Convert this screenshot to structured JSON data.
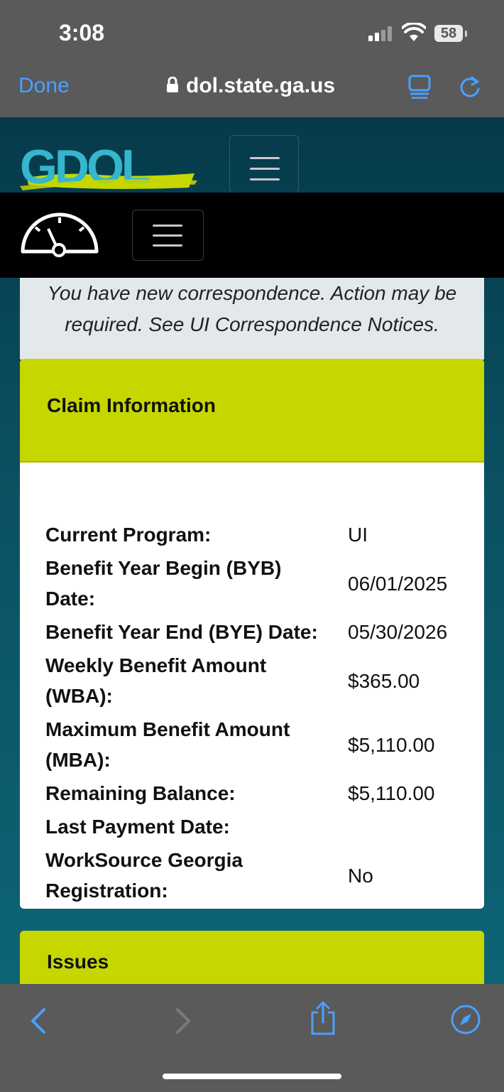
{
  "status_bar": {
    "time": "3:08",
    "battery": "58"
  },
  "browser": {
    "done_label": "Done",
    "url": "dol.state.ga.us"
  },
  "site": {
    "logo_text": "GDOL"
  },
  "notice": {
    "line1": "You have new correspondence. Action may be",
    "line2": "required. See UI Correspondence Notices."
  },
  "claim": {
    "title": "Claim Information",
    "rows": [
      {
        "label": "Current Program:",
        "value": "UI"
      },
      {
        "label": "Benefit Year Begin (BYB) Date:",
        "value": "06/01/2025"
      },
      {
        "label": "Benefit Year End (BYE) Date:",
        "value": "05/30/2026"
      },
      {
        "label": "Weekly Benefit Amount (WBA):",
        "value": "$365.00"
      },
      {
        "label": "Maximum Benefit Amount (MBA):",
        "value": "$5,110.00"
      },
      {
        "label": "Remaining Balance:",
        "value": "$5,110.00"
      },
      {
        "label": "Last Payment Date:",
        "value": ""
      },
      {
        "label": "WorkSource Georgia Registration:",
        "value": "No"
      }
    ]
  },
  "issues": {
    "title": "Issues"
  },
  "colors": {
    "accent": "#c6d700",
    "link": "#4aa0ff",
    "header_bg": "#063a4a"
  },
  "icons": [
    "lock-icon",
    "reader-icon",
    "reload-icon",
    "gauge-icon",
    "menu-icon",
    "back-icon",
    "forward-icon",
    "share-icon",
    "compass-icon"
  ]
}
